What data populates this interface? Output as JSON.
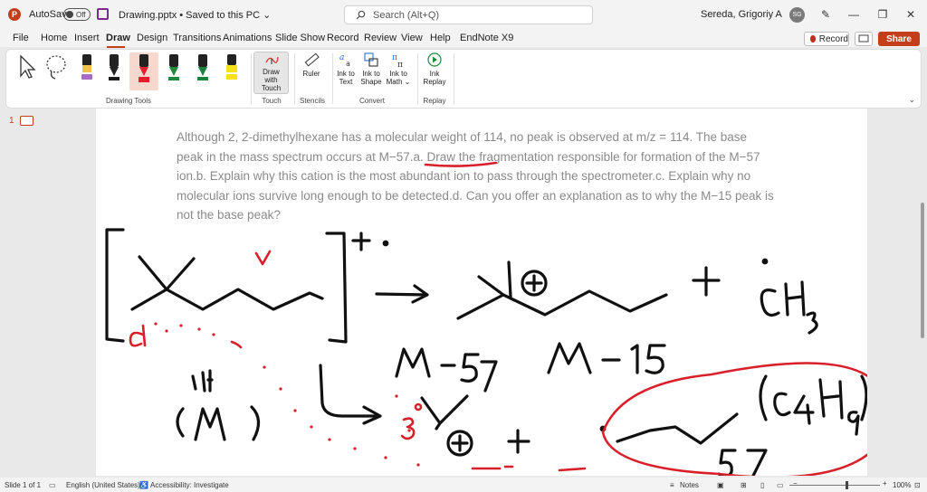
{
  "titlebar": {
    "autosave_label": "AutoSave",
    "autosave_state": "Off",
    "doc_title": "Drawing.pptx • Saved to this PC ⌄",
    "search_placeholder": "Search (Alt+Q)",
    "user_name": "Sereda, Grigoriy A",
    "user_initials": "SG"
  },
  "menu": {
    "items": [
      "File",
      "Home",
      "Insert",
      "Draw",
      "Design",
      "Transitions",
      "Animations",
      "Slide Show",
      "Record",
      "Review",
      "View",
      "Help",
      "EndNote X9"
    ],
    "active": "Draw",
    "record_label": "Record",
    "share_label": "Share"
  },
  "ribbon": {
    "groups": {
      "drawing_tools": "Drawing Tools",
      "touch": "Touch",
      "stencils": "Stencils",
      "convert": "Convert",
      "replay": "Replay"
    },
    "buttons": {
      "draw_with_touch_1": "Draw with",
      "draw_with_touch_2": "Touch",
      "ruler": "Ruler",
      "ink_to_text_1": "Ink to",
      "ink_to_text_2": "Text",
      "ink_to_shape_1": "Ink to",
      "ink_to_shape_2": "Shape",
      "ink_to_math_1": "Ink to",
      "ink_to_math_2": "Math ⌄",
      "ink_replay_1": "Ink",
      "ink_replay_2": "Replay"
    },
    "pens": [
      {
        "name": "black-pen",
        "color": "#1b1b1b"
      },
      {
        "name": "red-pen",
        "color": "#e0212b"
      },
      {
        "name": "green-pen",
        "color": "#1e8a3a"
      },
      {
        "name": "green-pen-2",
        "color": "#19823c"
      },
      {
        "name": "highlighter-yellow",
        "color": "#f4e11a"
      }
    ]
  },
  "thumbnail_panel": {
    "slide_number": "1"
  },
  "slide": {
    "question": "Although 2, 2-dimethylhexane has a molecular weight of 114, no peak is observed at m/z = 114. The base peak in the mass spectrum occurs at M−57.a. Draw the fragmentation responsible for formation of the M−57 ion.b. Explain why this cation is the most abundant ion to pass through the spectrometer.c. Explain why no molecular ions survive long enough to be detected.d. Can you offer an explanation as to why the M−15 peak is not the base peak?",
    "ink_colors": {
      "black": "#111111",
      "red": "#d8202a"
    }
  },
  "statusbar": {
    "slide_info": "Slide 1 of 1",
    "language": "English (United States)",
    "accessibility": "Accessibility: Investigate",
    "notes": "Notes",
    "zoom": "100%"
  }
}
